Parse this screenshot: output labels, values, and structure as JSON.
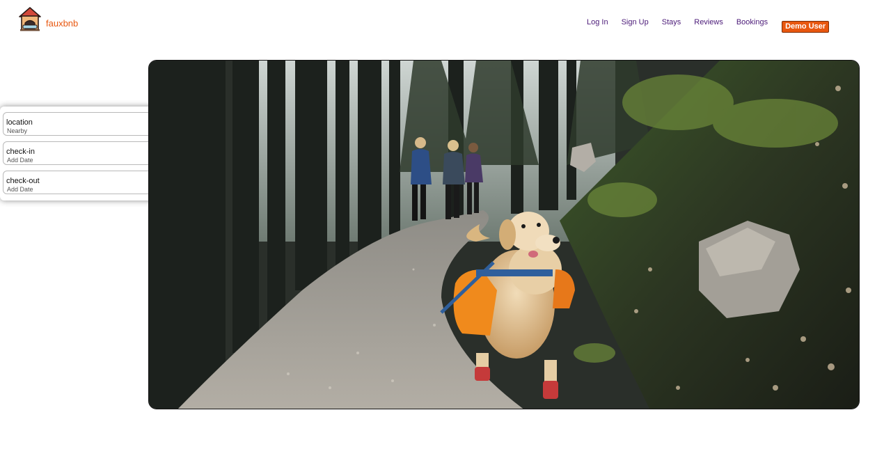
{
  "brand": {
    "name": "fauxbnb",
    "logo_icon": "house-logo-icon",
    "accent_color": "#e8570f"
  },
  "nav": {
    "links": [
      "Log In",
      "Sign Up",
      "Stays",
      "Reviews",
      "Bookings"
    ],
    "demo_button": "Demo User",
    "link_color": "#4b1a78"
  },
  "search": {
    "fields": [
      {
        "label": "location",
        "value": "Nearby"
      },
      {
        "label": "check-in",
        "value": "Add Date"
      },
      {
        "label": "check-out",
        "value": "Add Date"
      }
    ]
  },
  "hero": {
    "image": "forest-trail-dog-hikers"
  }
}
